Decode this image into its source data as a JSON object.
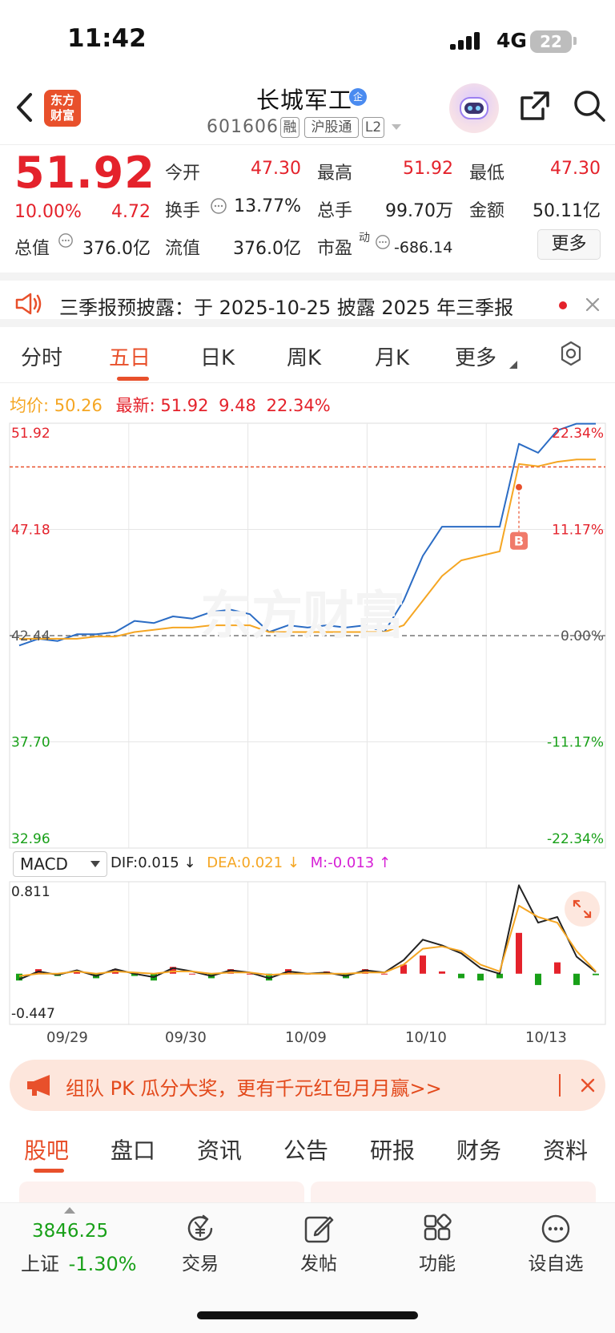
{
  "status_bar": {
    "time": "11:42",
    "network": "4G",
    "battery": "22"
  },
  "nav": {
    "logo_text": "东方\n财富",
    "stock_name": "长城军工",
    "stock_badge": "企",
    "stock_code": "601606",
    "tags": [
      "融",
      "沪股通",
      "L2"
    ]
  },
  "quote": {
    "price": "51.92",
    "change_pct": "10.00%",
    "change": "4.72",
    "open_label": "今开",
    "open": "47.30",
    "high_label": "最高",
    "high": "51.92",
    "low_label": "最低",
    "low": "47.30",
    "turnover_label": "换手",
    "turnover": "13.77%",
    "volume_label": "总手",
    "volume": "99.70万",
    "amount_label": "金额",
    "amount": "50.11亿",
    "mcap_label": "总值",
    "mcap": "376.0亿",
    "float_label": "流值",
    "float": "376.0亿",
    "pe_label": "市盈",
    "pe_sup": "动",
    "pe": "-686.14",
    "more_button": "更多"
  },
  "notice": {
    "text": "三季报预披露：于 2025-10-25 披露 2025 年三季报"
  },
  "chart_tabs": {
    "items": [
      "分时",
      "五日",
      "日K",
      "周K",
      "月K",
      "更多"
    ],
    "active": "五日"
  },
  "info_line": {
    "avg_label": "均价:",
    "avg": "50.26",
    "latest_label": "最新:",
    "latest": "51.92",
    "change": "9.48",
    "change_pct": "22.34%"
  },
  "chart_data": {
    "type": "line",
    "x": [
      "09/29",
      "09/30",
      "10/09",
      "10/10",
      "10/13"
    ],
    "left_axis_labels": [
      "51.92",
      "47.18",
      "42.44",
      "37.70",
      "32.96"
    ],
    "right_axis_labels": [
      "22.34%",
      "11.17%",
      "0.00%",
      "-11.17%",
      "-22.34%"
    ],
    "ylim": [
      32.96,
      51.92
    ],
    "prev_close": 42.44,
    "series": [
      {
        "name": "",
        "values": [
          42.0,
          42.3,
          42.2,
          42.5,
          42.5,
          42.6,
          43.1,
          43.0,
          43.3,
          43.2,
          43.5,
          43.6,
          43.4,
          42.6,
          42.9,
          42.8,
          42.9,
          42.8,
          42.9,
          42.6,
          44.0,
          46.0,
          47.3,
          47.3,
          47.3,
          47.3,
          51.0,
          50.6,
          51.6,
          51.9,
          51.9
        ],
        "color": "#2b6cc4"
      },
      {
        "name": "",
        "values": [
          42.3,
          42.3,
          42.3,
          42.3,
          42.4,
          42.4,
          42.6,
          42.7,
          42.8,
          42.8,
          42.9,
          42.9,
          42.9,
          42.6,
          42.6,
          42.6,
          42.6,
          42.6,
          42.6,
          42.6,
          42.9,
          44.0,
          45.1,
          45.8,
          46.0,
          46.2,
          50.1,
          50.0,
          50.2,
          50.3,
          50.3
        ],
        "color": "#f5a623"
      }
    ],
    "annotations": [
      {
        "text": "B",
        "series": 0
      }
    ],
    "macd": {
      "ylim": [
        -0.447,
        0.811
      ],
      "top_label": "0.811",
      "bottom_label": "-0.447",
      "indicator": "MACD",
      "dif_label": "DIF:0.015 ↓",
      "dea_label": "DEA:0.021 ↓",
      "m_label": "M:-0.013 ↑",
      "dif": [
        -0.05,
        0.02,
        -0.01,
        0.03,
        -0.02,
        0.04,
        0.0,
        -0.03,
        0.05,
        0.02,
        -0.02,
        0.03,
        0.01,
        -0.04,
        0.02,
        0.0,
        0.01,
        -0.02,
        0.03,
        0.01,
        0.12,
        0.3,
        0.25,
        0.18,
        0.05,
        0.0,
        0.78,
        0.45,
        0.5,
        0.15,
        0.015
      ],
      "dea": [
        -0.02,
        0.0,
        0.0,
        0.02,
        0.0,
        0.02,
        0.01,
        0.0,
        0.02,
        0.02,
        0.0,
        0.01,
        0.01,
        -0.01,
        0.0,
        0.0,
        0.0,
        0.0,
        0.01,
        0.01,
        0.08,
        0.22,
        0.24,
        0.2,
        0.08,
        0.02,
        0.6,
        0.5,
        0.45,
        0.2,
        0.021
      ],
      "m": [
        -0.06,
        0.04,
        -0.02,
        0.02,
        -0.04,
        0.04,
        -0.02,
        -0.06,
        0.06,
        0.0,
        -0.04,
        0.04,
        0.0,
        -0.06,
        0.04,
        0.0,
        0.02,
        -0.04,
        0.04,
        0.0,
        0.08,
        0.16,
        0.02,
        -0.04,
        -0.06,
        -0.04,
        0.36,
        -0.1,
        0.1,
        -0.1,
        -0.013
      ]
    }
  },
  "promo": {
    "text": "组队 PK 瓜分大奖，更有千元红包月月赢>>"
  },
  "bottom_tabs": {
    "items": [
      "股吧",
      "盘口",
      "资讯",
      "公告",
      "研报",
      "财务",
      "资料"
    ],
    "active": "股吧"
  },
  "toolbar": {
    "index_value": "3846.25",
    "index_name": "上证",
    "index_change": "-1.30%",
    "items": [
      {
        "label": "交易",
        "icon": "yen-exchange-icon"
      },
      {
        "label": "发帖",
        "icon": "edit-icon"
      },
      {
        "label": "功能",
        "icon": "grid-icon"
      },
      {
        "label": "设自选",
        "icon": "more-dots-icon"
      }
    ]
  },
  "colors": {
    "up": "#e4222b",
    "down": "#18a018",
    "accent": "#e8502b",
    "price_line": "#2b6cc4",
    "avg_line": "#f5a623"
  }
}
